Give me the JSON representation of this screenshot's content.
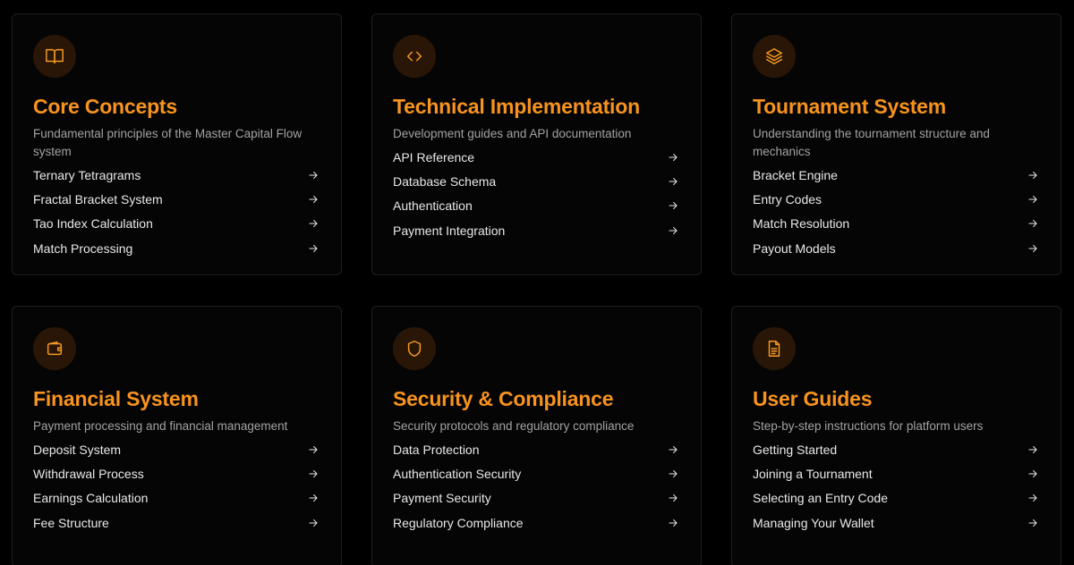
{
  "accent_color": "#f7931e",
  "cards": [
    {
      "icon": "book-icon",
      "title": "Core Concepts",
      "description": "Fundamental principles of the Master Capital Flow system",
      "links": [
        "Ternary Tetragrams",
        "Fractal Bracket System",
        "Tao Index Calculation",
        "Match Processing"
      ]
    },
    {
      "icon": "code-icon",
      "title": "Technical Implementation",
      "description": "Development guides and API documentation",
      "links": [
        "API Reference",
        "Database Schema",
        "Authentication",
        "Payment Integration"
      ]
    },
    {
      "icon": "layers-icon",
      "title": "Tournament System",
      "description": "Understanding the tournament structure and mechanics",
      "links": [
        "Bracket Engine",
        "Entry Codes",
        "Match Resolution",
        "Payout Models"
      ]
    },
    {
      "icon": "wallet-icon",
      "title": "Financial System",
      "description": "Payment processing and financial management",
      "links": [
        "Deposit System",
        "Withdrawal Process",
        "Earnings Calculation",
        "Fee Structure"
      ]
    },
    {
      "icon": "shield-icon",
      "title": "Security & Compliance",
      "description": "Security protocols and regulatory compliance",
      "links": [
        "Data Protection",
        "Authentication Security",
        "Payment Security",
        "Regulatory Compliance"
      ]
    },
    {
      "icon": "document-icon",
      "title": "User Guides",
      "description": "Step-by-step instructions for platform users",
      "links": [
        "Getting Started",
        "Joining a Tournament",
        "Selecting an Entry Code",
        "Managing Your Wallet"
      ]
    }
  ]
}
